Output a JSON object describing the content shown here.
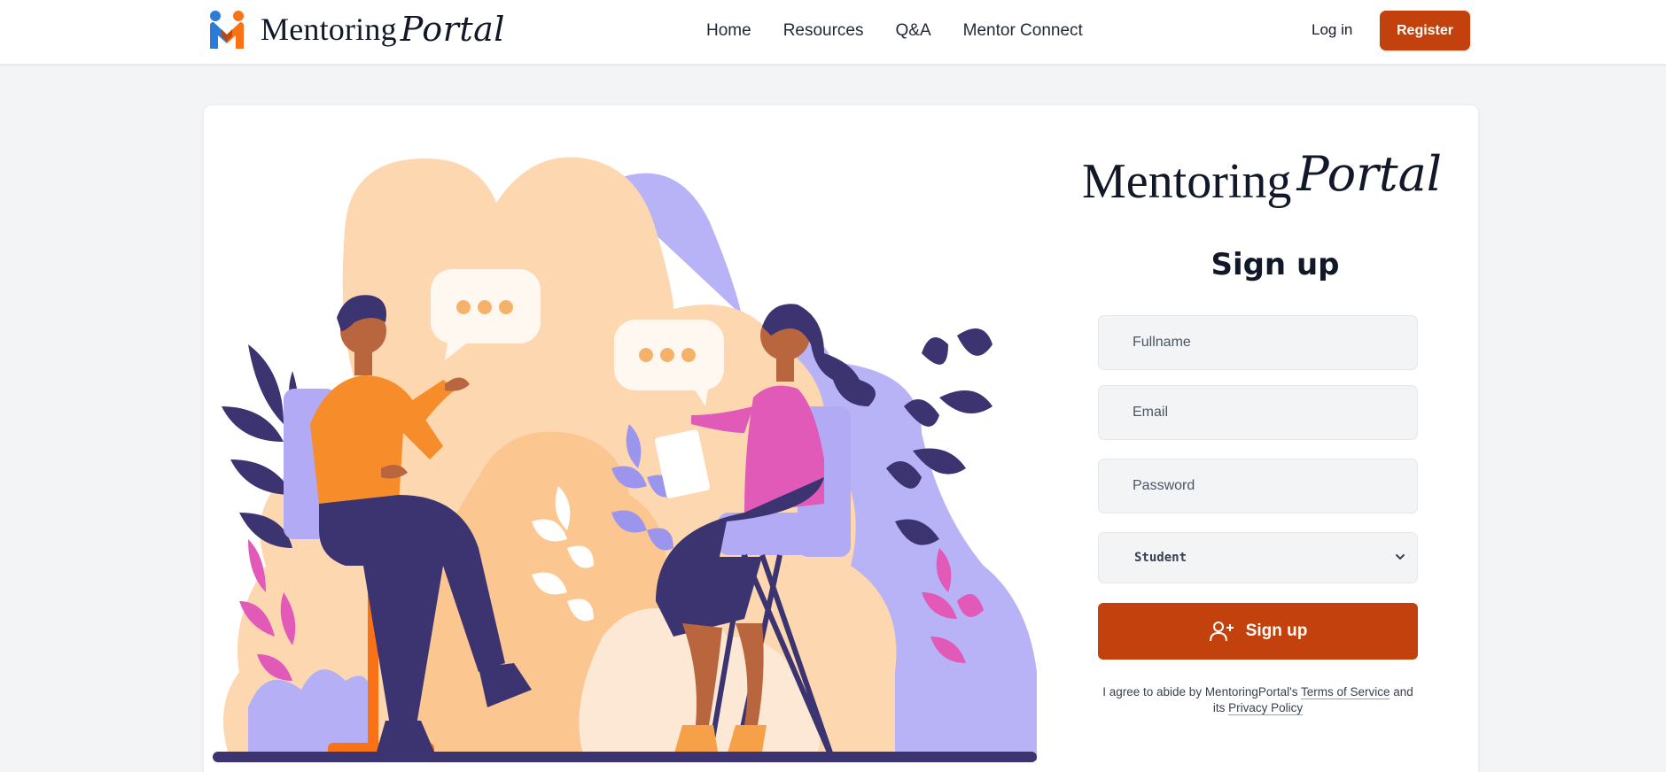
{
  "header": {
    "logo_word": "Mentoring",
    "logo_script": "Portal",
    "nav": [
      "Home",
      "Resources",
      "Q&A",
      "Mentor Connect"
    ],
    "login_label": "Log in",
    "register_label": "Register"
  },
  "form": {
    "brand_word": "Mentoring",
    "brand_script": "Portal",
    "title": "Sign up",
    "fullname_placeholder": "Fullname",
    "email_placeholder": "Email",
    "password_placeholder": "Password",
    "role_selected": "Student",
    "submit_label": "Sign up",
    "terms_prefix": "I agree to abide by MentoringPortal's ",
    "terms_link": "Terms of Service",
    "terms_mid": " and its ",
    "privacy_link": "Privacy Policy"
  },
  "colors": {
    "accent": "#c2410c",
    "background": "#f3f4f6",
    "field_bg": "#f3f4f6"
  },
  "icons": {
    "logo": "m-logo-icon",
    "submit": "user-plus-icon",
    "select": "chevron-down-icon"
  }
}
